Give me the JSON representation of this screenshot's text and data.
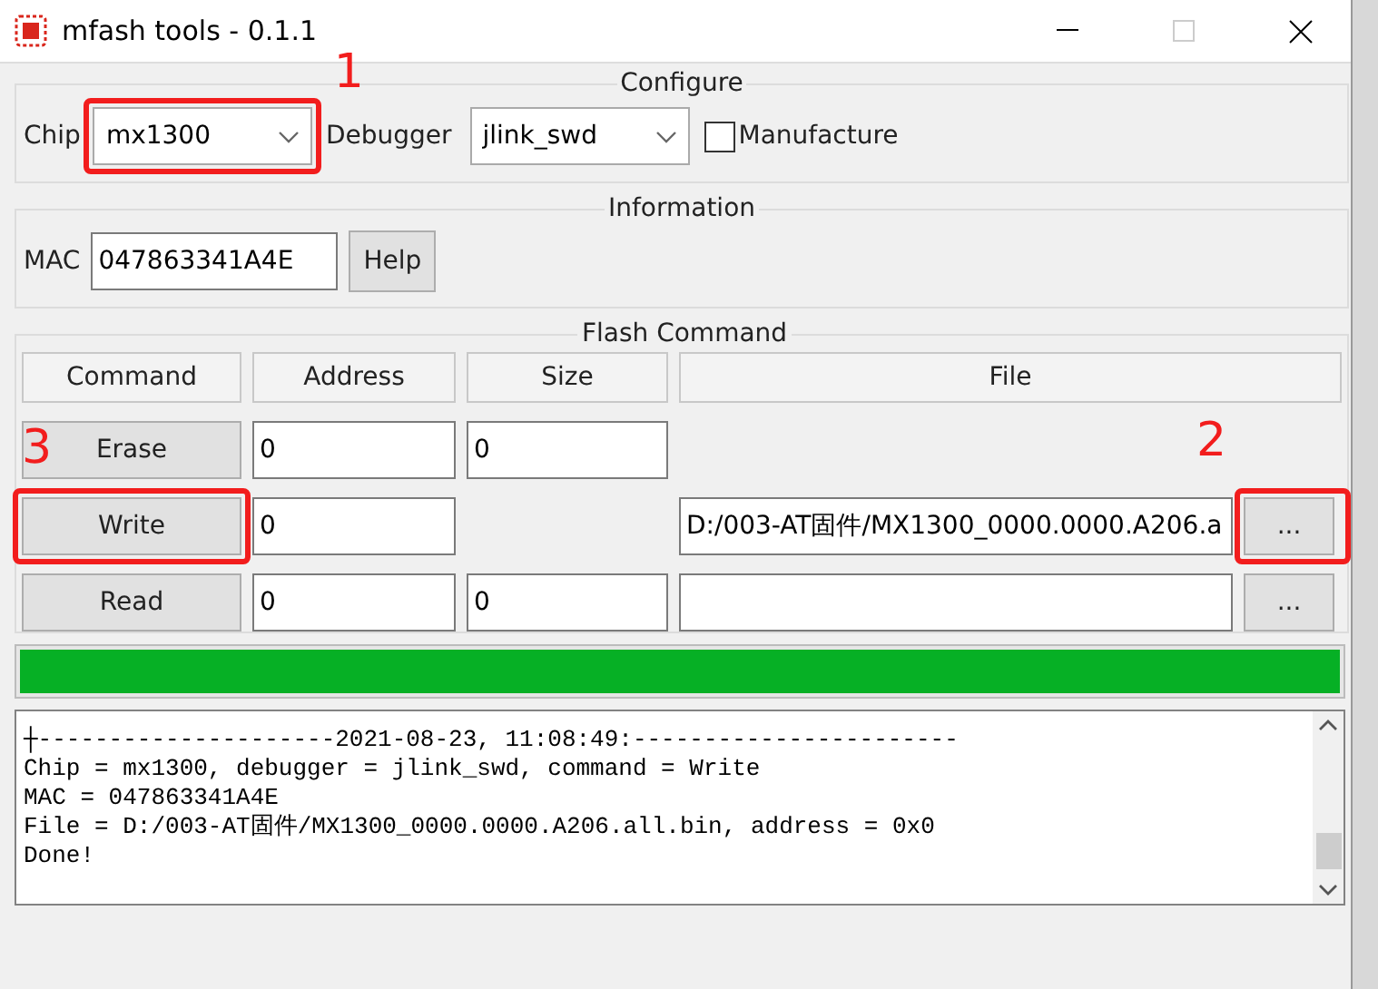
{
  "window": {
    "title": "mfash tools - 0.1.1"
  },
  "configure": {
    "title": "Configure",
    "chip": {
      "label": "Chip",
      "value": "mx1300",
      "highlighted": true,
      "callout": "1"
    },
    "debugger": {
      "label": "Debugger",
      "value": "jlink_swd"
    },
    "manufacture": {
      "label": "Manufacture",
      "checked": false
    }
  },
  "information": {
    "title": "Information",
    "mac": {
      "label": "MAC",
      "value": "047863341A4E"
    },
    "help_button": "Help"
  },
  "flash_command": {
    "title": "Flash Command",
    "columns": [
      "Command",
      "Address",
      "Size",
      "File"
    ],
    "rows": [
      {
        "command": "Erase",
        "address": "0",
        "size_field": true,
        "size": "0",
        "file_field": false,
        "highlighted": false
      },
      {
        "command": "Write",
        "address": "0",
        "size_field": false,
        "file_field": true,
        "file": "D:/003-AT固件/MX1300_0000.0000.A206.a",
        "browse": "...",
        "browse_highlighted": true,
        "browse_callout": "2",
        "highlighted": true,
        "callout": "3"
      },
      {
        "command": "Read",
        "address": "0",
        "size_field": true,
        "size": "0",
        "file_field": true,
        "browse": "...",
        "browse_highlighted": false,
        "highlighted": false
      }
    ]
  },
  "progress": {
    "level": 1
  },
  "log": {
    "lines": [
      "┼---------------------2021-08-23, 11:08:49:-----------------------",
      "Chip = mx1300, debugger = jlink_swd, command = Write",
      "MAC = 047863341A4E",
      "File = D:/003-AT固件/MX1300_0000.0000.A206.all.bin, address = 0x0",
      "Done!"
    ]
  }
}
